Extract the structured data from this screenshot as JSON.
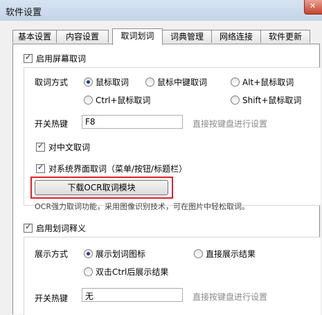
{
  "window": {
    "title": "软件设置"
  },
  "tabs": [
    {
      "label": "基本设置"
    },
    {
      "label": "内容设置"
    },
    {
      "label": "取词划词",
      "active": true
    },
    {
      "label": "词典管理"
    },
    {
      "label": "网络连接"
    },
    {
      "label": "软件更新"
    }
  ],
  "screen_capture": {
    "enable_label": "启用屏幕取词",
    "enabled": true,
    "method_label": "取词方式",
    "methods": [
      {
        "label": "鼠标取词",
        "selected": true
      },
      {
        "label": "鼠标中键取词",
        "selected": false
      },
      {
        "label": "Alt+鼠标取词",
        "selected": false
      },
      {
        "label": "Ctrl+鼠标取词",
        "selected": false
      },
      {
        "label": "Shift+鼠标取词",
        "selected": false
      }
    ],
    "hotkey_label": "开关热键",
    "hotkey_value": "F8",
    "hotkey_hint": "直接按键盘进行设置",
    "chinese_label": "对中文取词",
    "chinese_checked": true,
    "system_ui_label": "对系统界面取词（菜单/按钮/标题栏）",
    "system_ui_checked": true,
    "ocr_button_label": "下载OCR取词模块",
    "ocr_description": "OCR强力取词功能，采用图像识别技术，可在图片中轻松取词。"
  },
  "word_selection": {
    "enable_label": "启用划词释义",
    "enabled": true,
    "display_label": "展示方式",
    "modes": [
      {
        "label": "展示划词图标",
        "selected": true
      },
      {
        "label": "直接展示结果",
        "selected": false
      },
      {
        "label": "双击Ctrl后展示结果",
        "selected": false
      }
    ],
    "hotkey_label": "开关热键",
    "hotkey_value": "无",
    "hotkey_hint": "直接按键盘进行设置"
  },
  "colors": {
    "highlight": "#e0202a"
  }
}
